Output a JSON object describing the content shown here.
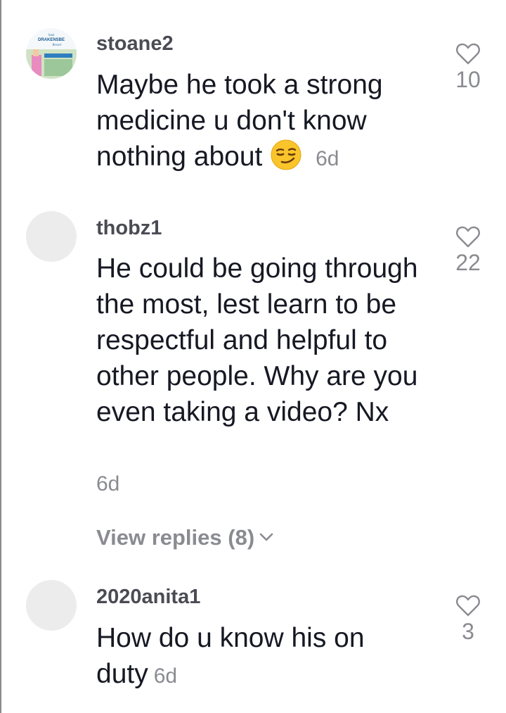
{
  "comments": [
    {
      "username": "stoane2",
      "text": "Maybe he took a strong medicine u don't know nothing about",
      "emoji": "smirking-face",
      "time": "6d",
      "likes": "10",
      "avatar_text_lines": [
        "Sani",
        "DRAKENSBE",
        "Resort"
      ]
    },
    {
      "username": "thobz1",
      "text": "He could be going through the most, lest learn to be respectful and helpful to other people. Why are you even taking a video? Nx",
      "time": "6d",
      "likes": "22",
      "view_replies": "View replies (8)"
    },
    {
      "username": "2020anita1",
      "text": "How do u know his on duty",
      "time": "6d",
      "likes": "3"
    }
  ],
  "icons": {
    "like": "heart-outline-icon",
    "expand": "chevron-down-icon"
  },
  "colors": {
    "text_primary": "#161823",
    "text_secondary": "#8a8b91",
    "username": "#4a4b53",
    "avatar_placeholder": "#ececec"
  }
}
